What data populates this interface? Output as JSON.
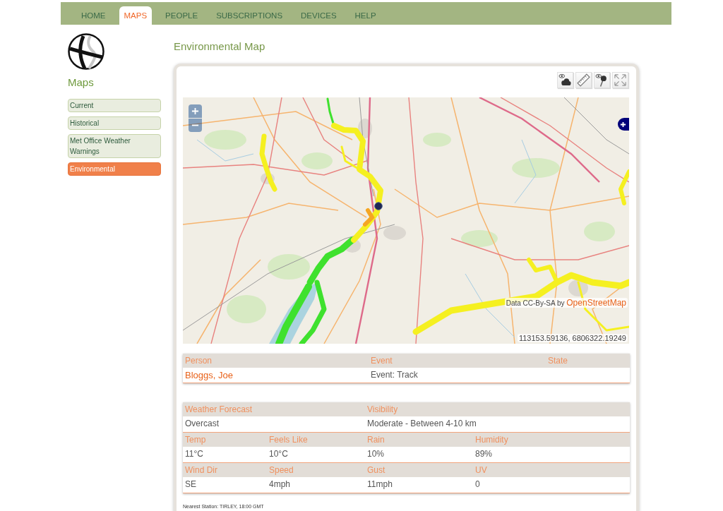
{
  "nav": {
    "tabs": [
      {
        "label": "HOME",
        "selected": false
      },
      {
        "label": "MAPS",
        "selected": true
      },
      {
        "label": "PEOPLE",
        "selected": false
      },
      {
        "label": "SUBSCRIPTIONS",
        "selected": false
      },
      {
        "label": "DEVICES",
        "selected": false
      },
      {
        "label": "HELP",
        "selected": false
      }
    ]
  },
  "sidebar": {
    "title": "Maps",
    "items": [
      {
        "label": "Current",
        "selected": false
      },
      {
        "label": "Historical",
        "selected": false
      },
      {
        "label": "Met Office Weather Warnings",
        "selected": false
      },
      {
        "label": "Environmental",
        "selected": true
      }
    ]
  },
  "main": {
    "title": "Environmental Map"
  },
  "map": {
    "attribution": "Data CC-By-SA by",
    "attribution_link": "OpenStreetMap",
    "coordinates": "113153.59136, 6806322.19249"
  },
  "person_table": {
    "columns": [
      "Person",
      "Event",
      "State"
    ],
    "rows": [
      {
        "cells": [
          "Bloggs, Joe",
          "Event: Track"
        ]
      }
    ]
  },
  "weather_table": {
    "sections": [
      {
        "columns": [
          "Weather Forecast",
          "Visibility"
        ],
        "values": [
          "Overcast",
          "Moderate - Between 4-10 km"
        ]
      },
      {
        "columns": [
          "Temp",
          "Feels Like",
          "Rain",
          "Humidity"
        ],
        "values": [
          "11°C",
          "10°C",
          "10%",
          "89%"
        ]
      },
      {
        "columns": [
          "Wind Dir",
          "Speed",
          "Gust",
          "UV"
        ],
        "values": [
          "SE",
          "4mph",
          "11mph",
          "0"
        ]
      }
    ]
  },
  "footnote": "Nearest Station: TIRLEY, 18:00 GMT"
}
